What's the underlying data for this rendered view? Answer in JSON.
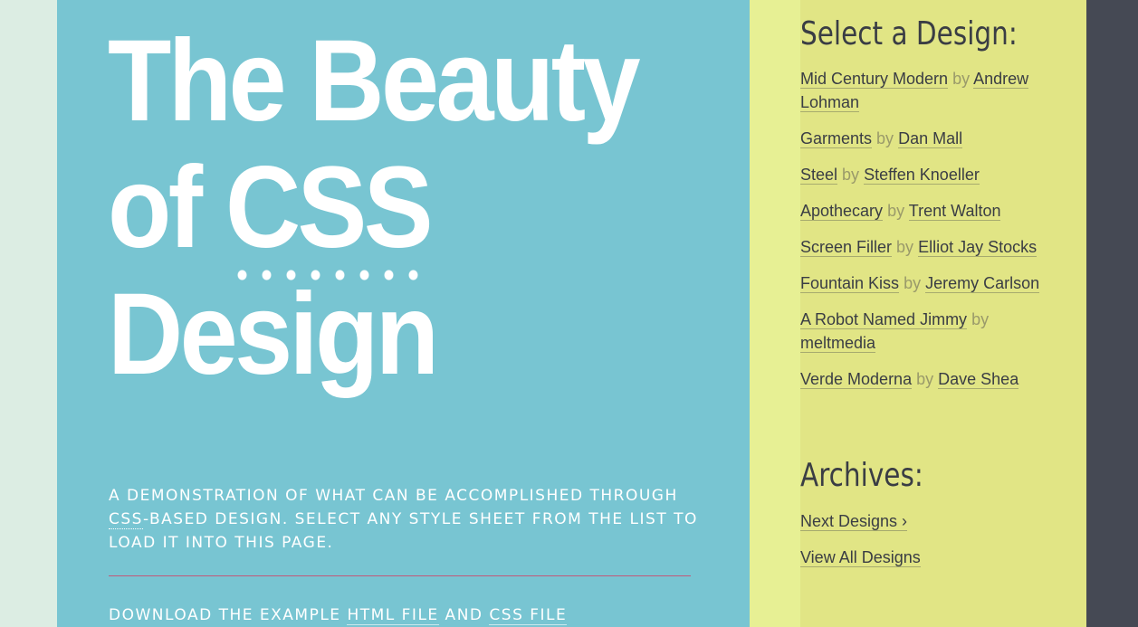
{
  "colors": {
    "left_strip": "#dcede3",
    "main_bg": "#78c5d2",
    "yellow_strip": "#e7f094",
    "sidebar_bg": "#e1e585",
    "dark_strip": "#454954",
    "rule": "#c2597a",
    "text_dark": "#3a3d44",
    "by_text": "#9a9a6a"
  },
  "header": {
    "title_part1": "The Beauty",
    "title_part2": "of",
    "title_abbr": "CSS",
    "title_part3": "Design"
  },
  "intro": {
    "text_before_abbr": "A demonstration of what can be accomplished through ",
    "abbr": "CSS",
    "text_after_abbr": "-based design. Select any style sheet from the list to load it into this page."
  },
  "download": {
    "prefix": "Download the example ",
    "html_link": "html file",
    "and_text": " and ",
    "css_link": "css file"
  },
  "sidebar": {
    "select_heading": "Select a Design:",
    "by_label": "by",
    "designs": [
      {
        "name": "Mid Century Modern",
        "author": "Andrew Lohman"
      },
      {
        "name": "Garments",
        "author": "Dan Mall"
      },
      {
        "name": "Steel",
        "author": "Steffen Knoeller"
      },
      {
        "name": "Apothecary",
        "author": "Trent Walton"
      },
      {
        "name": "Screen Filler",
        "author": "Elliot Jay Stocks"
      },
      {
        "name": "Fountain Kiss",
        "author": "Jeremy Carlson"
      },
      {
        "name": "A Robot Named Jimmy",
        "author": "meltmedia"
      },
      {
        "name": "Verde Moderna",
        "author": "Dave Shea"
      }
    ],
    "archives_heading": "Archives:",
    "archives": [
      {
        "label": "Next Designs ›"
      },
      {
        "label": "View All Designs"
      }
    ]
  }
}
